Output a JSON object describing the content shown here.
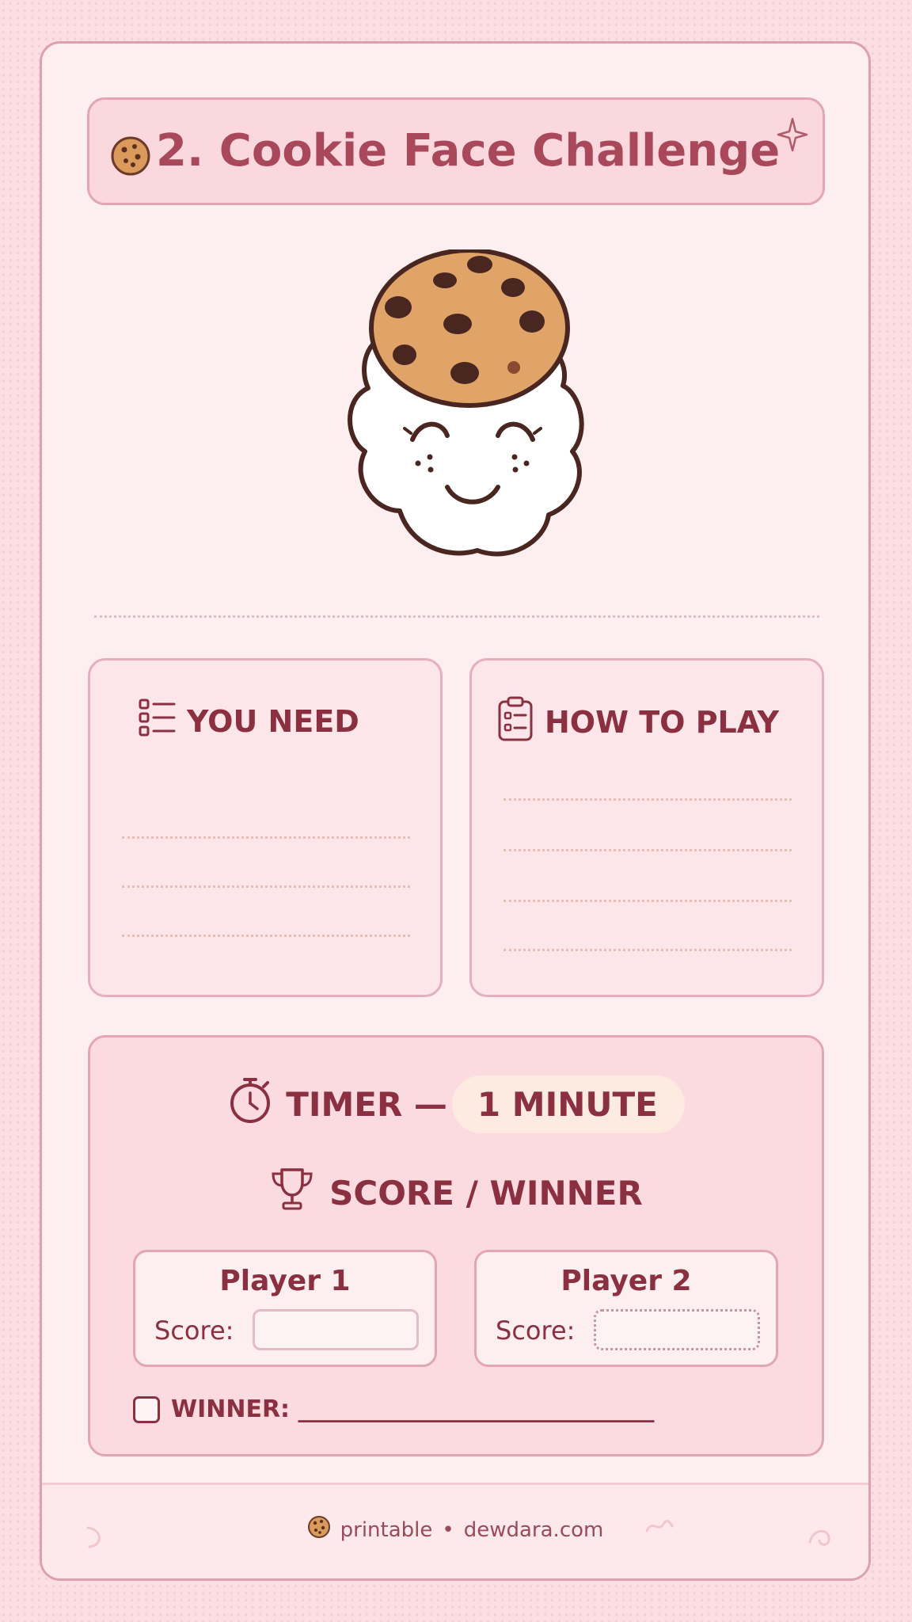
{
  "title": "2. Cookie Face Challenge",
  "sections": {
    "you_need": "YOU NEED",
    "how_to_play": "HOW TO PLAY"
  },
  "timer": {
    "label": "TIMER —",
    "duration": "1 MINUTE"
  },
  "score_heading": "SCORE / WINNER",
  "players": [
    {
      "name": "Player 1",
      "score_label": "Score:"
    },
    {
      "name": "Player 2",
      "score_label": "Score:"
    }
  ],
  "winner": {
    "label": "WINNER: ______________________________"
  },
  "footer": {
    "printable": "printable",
    "dot": "•",
    "site": "dewdara.com"
  },
  "icons": [
    "cookie-icon",
    "sparkle-icon",
    "checklist-icon",
    "clipboard-icon",
    "stopwatch-icon",
    "trophy-icon"
  ],
  "colors": {
    "accent": "#a8485a",
    "text": "#8a3040",
    "background": "#fbdfe3",
    "cookie": "#d99a5c"
  }
}
